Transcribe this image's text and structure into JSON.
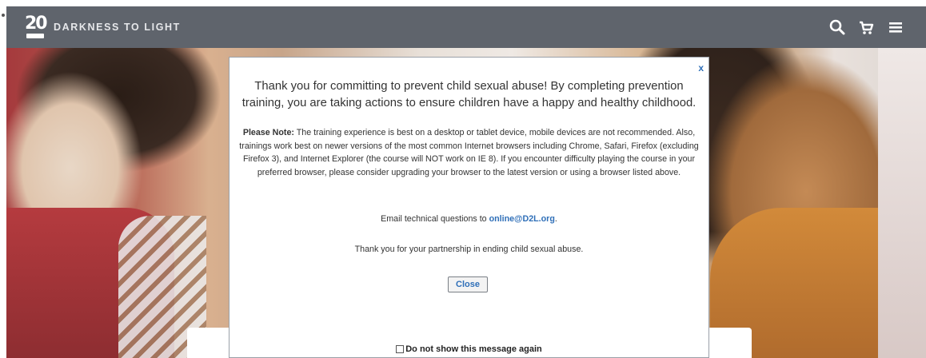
{
  "header": {
    "logo_number": "20",
    "logo_text": "DARKNESS TO LIGHT",
    "icons": [
      "search-icon",
      "cart-icon",
      "menu-icon"
    ]
  },
  "modal": {
    "close_label": "x",
    "lead": "Thank you for committing to prevent child sexual abuse! By completing prevention training, you are taking actions to ensure children have a happy and healthy childhood.",
    "note_label": "Please Note:",
    "note_text": " The training experience is best on a desktop or tablet device, mobile devices are not recommended. Also, trainings work best on newer versions of the most common Internet browsers including Chrome, Safari, Firefox (excluding Firefox 3), and Internet Explorer (the course will NOT work on IE 8). If you encounter difficulty playing the course in your preferred browser, please consider upgrading your browser to the latest version or using a browser listed above.",
    "email_prefix": "Email technical questions to ",
    "email_link": "online@D2L.org",
    "email_suffix": ".",
    "thanks": "Thank you for your partnership in ending child sexual abuse.",
    "close_button": "Close",
    "dont_show": "Do not show this message again"
  },
  "colors": {
    "topbar": "#5f646c",
    "link": "#2f6fb8"
  }
}
